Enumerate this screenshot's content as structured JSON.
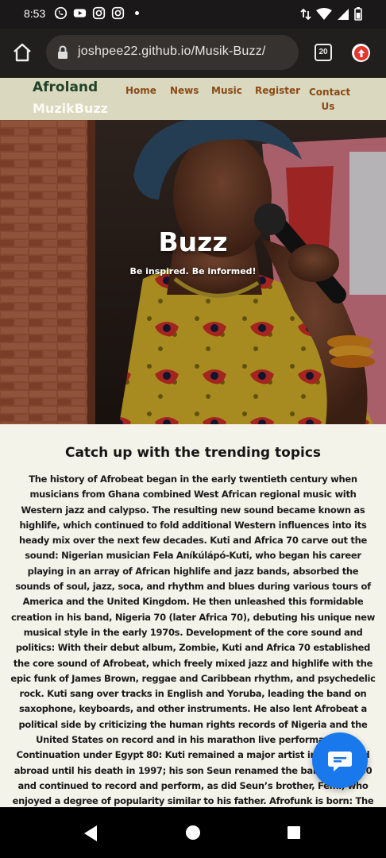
{
  "status_bar": {
    "time": "8:53",
    "apps": [
      "whatsapp-icon",
      "youtube-icon",
      "instagram-icon",
      "instagram-icon"
    ]
  },
  "browser": {
    "url": "joshpee22.github.io/Musik-Buzz/",
    "tab_count": "20"
  },
  "site": {
    "brand_line1": "Afroland",
    "brand_line2": "MuzikBuzz",
    "nav": [
      "Home",
      "News",
      "Music",
      "Register",
      "Contact Us"
    ]
  },
  "hero": {
    "title": "Buzz",
    "subtitle": "Be inspired. Be informed!"
  },
  "main": {
    "heading": "Catch up with the trending topics",
    "article": "The history of Afrobeat began in the early twentieth century when musicians from Ghana combined West African regional music with Western jazz and calypso. The resulting new sound became known as highlife, which continued to fold additional Western influences into its heady mix over the next few decades. Kuti and Africa 70 carve out the sound: Nigerian musician Fela Aníkúlápó-Kuti, who began his career playing in an array of African highlife and jazz bands, absorbed the sounds of soul, jazz, soca, and rhythm and blues during various tours of America and the United Kingdom. He then unleashed this formidable creation in his band, Nigeria 70 (later Africa 70), debuting his unique new musical style in the early 1970s. Development of the core sound and politics: With their debut album, Zombie, Kuti and Africa 70 established the core sound of Afrobeat, which freely mixed jazz and highlife with the epic funk of James Brown, reggae and Caribbean rhythm, and psychedelic rock. Kuti sang over tracks in English and Yoruba, leading the band on saxophone, keyboards, and other instruments. He also lent Afrobeat a political side by criticizing the human rights records of Nigeria and the United States on record and in his marathon live performances. Continuation under Egypt 80: Kuti remained a major artist in Africa and abroad until his death in 1997; his son Seun renamed the band Egypt 80 and continued to record and perform, as did Seun’s brother, Femi, who enjoyed a degree of popularity similar to his father. Afrofunk is born: The most successful figure from Kuti’s bands was undoubtedly drummer Tony Allen, who expanded on the Afrobeat sound by mixing in elements of hip-hop, dub, and electronica to form a new subgenre called Afrofunk. Allen enjoyed even wider exposure than his former bandleader"
  },
  "colors": {
    "nav_bg": "#dad9c0",
    "brand_green": "#21432a",
    "nav_link": "#8a4a16",
    "content_bg": "#f4f3ea",
    "fab_blue": "#1878ec"
  }
}
